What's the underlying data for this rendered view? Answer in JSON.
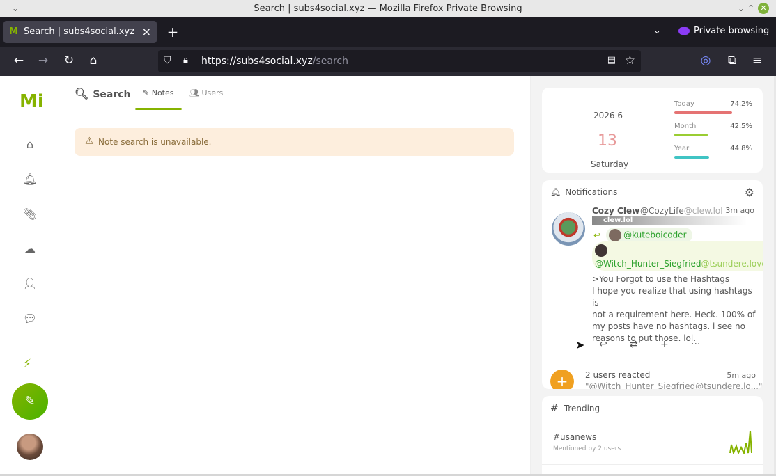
{
  "window": {
    "title": "Search | subs4social.xyz — Mozilla Firefox Private Browsing",
    "min_icon": "minimize-icon",
    "max_icon": "maximize-icon",
    "close_icon": "close-icon"
  },
  "browser": {
    "tab_title": "Search | subs4social.xyz",
    "tab_close": "×",
    "new_tab": "+",
    "private_label": "Private browsing",
    "url_host": "https://subs4social.xyz",
    "url_path": "/search"
  },
  "sidebar": {
    "logo": "Mi",
    "items": [
      {
        "name": "home",
        "icon": "home-icon"
      },
      {
        "name": "notifications",
        "icon": "bell-icon"
      },
      {
        "name": "clips",
        "icon": "paperclip-icon"
      },
      {
        "name": "drive",
        "icon": "cloud-icon"
      },
      {
        "name": "follow-requests",
        "icon": "user-plus-icon"
      },
      {
        "name": "chat",
        "icon": "messages-icon"
      }
    ]
  },
  "main": {
    "title": "Search",
    "tabs": [
      {
        "label": "Notes",
        "active": true
      },
      {
        "label": "Users",
        "active": false
      }
    ],
    "warning": "Note search is unavailable."
  },
  "calendar": {
    "year_month": "2026  6",
    "day": "13",
    "weekday": "Saturday",
    "rows": [
      {
        "label": "Today",
        "percent": "74.2%",
        "value": 0.742,
        "color": "#e57373"
      },
      {
        "label": "Month",
        "percent": "42.5%",
        "value": 0.425,
        "color": "#9acd32"
      },
      {
        "label": "Year",
        "percent": "44.8%",
        "value": 0.448,
        "color": "#40c4c4"
      }
    ]
  },
  "notifications": {
    "title": "Notifications",
    "note": {
      "name": "Cozy Clew",
      "handle": "@CozyLife",
      "host": "@clew.lol",
      "time": "3m ago",
      "badge": "clew.lol",
      "reply_to": "@kuteboicoder",
      "mention_user": "@Witch_Hunter_Siegfried",
      "mention_host": "@tsundere.love",
      "lines": [
        ">You Forgot to use the Hashtags",
        "I hope you realize that using hashtags is",
        "not a requirement here. Heck. 100% of",
        "my posts have no hashtags. i see no",
        "reasons to put those. lol."
      ]
    },
    "reaction": {
      "text": "2 users reacted",
      "time": "5m ago",
      "preview": "\"@Witch_Hunter_Siegfried@tsundere.lo...\""
    }
  },
  "trending": {
    "title": "Trending",
    "items": [
      {
        "tag": "#usanews",
        "mentioned": "Mentioned by 2 users"
      }
    ]
  },
  "colors": {
    "accent": "#86b300",
    "warning_bg": "#fdeedd",
    "browser_dark": "#1c1b22"
  }
}
